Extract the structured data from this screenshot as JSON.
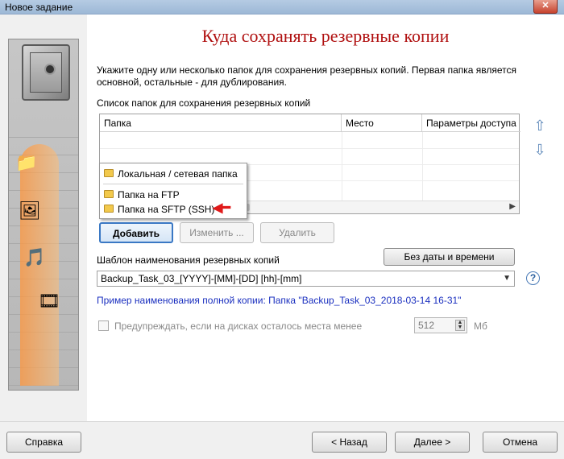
{
  "window": {
    "title": "Новое задание",
    "close_glyph": "✕"
  },
  "sidebar": {
    "icons": [
      "safe-icon",
      "folder-icon",
      "picture-icon",
      "music-icon",
      "film-icon"
    ]
  },
  "main": {
    "heading": "Куда сохранять резервные копии",
    "description": "Укажите одну или несколько папок для сохранения резервных копий. Первая папка является основной, остальные - для дублирования.",
    "list_label": "Список папок для сохранения резервных копий",
    "table": {
      "columns": [
        "Папка",
        "Место",
        "Параметры доступа"
      ],
      "rows": []
    },
    "dropdown": {
      "items": [
        {
          "label": "Локальная / сетевая папка"
        },
        {
          "label": "Папка на FTP"
        },
        {
          "label": "Папка на SFTP (SSH)"
        }
      ]
    },
    "buttons": {
      "add": "Добавить",
      "edit": "Изменить ...",
      "delete": "Удалить",
      "no_date": "Без даты и времени"
    },
    "template_label": "Шаблон наименования резервных копий",
    "template_value": "Backup_Task_03_[YYYY]-[MM]-[DD] [hh]-[mm]",
    "example": "Пример наименования полной копии: Папка \"Backup_Task_03_2018-03-14 16-31\"",
    "warn_label": "Предупреждать, если на дисках осталось места менее",
    "warn_value": "512",
    "warn_unit": "Мб"
  },
  "footer": {
    "help": "Справка",
    "back": "< Назад",
    "next": "Далее >",
    "cancel": "Отмена"
  },
  "colors": {
    "heading": "#b01010",
    "example_link": "#1a2fbf",
    "red_arrow": "#e01a1a"
  }
}
